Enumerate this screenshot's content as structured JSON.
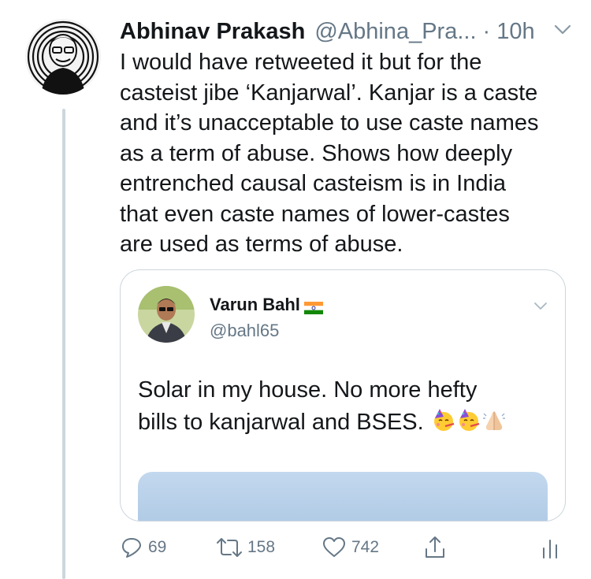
{
  "tweet": {
    "author_name": "Abhinav Prakash",
    "author_handle": "@Abhina_Pra...",
    "time": "· 10h",
    "text_lines": [
      "I would have retweeted it but for the",
      "casteist jibe ‘Kanjarwal’. Kanjar is a caste",
      "and it’s unacceptable to use caste names",
      "as a term of abuse. Shows how deeply",
      "entrenched causal casteism is in India",
      "that even caste names of lower-castes",
      "are used as terms of abuse."
    ]
  },
  "quoted": {
    "author_name": "Varun Bahl",
    "author_handle": "@bahl65",
    "text_lines": [
      "Solar in my house. No more hefty",
      "bills to kanjarwal and BSES."
    ],
    "emojis": [
      "partying-face",
      "partying-face",
      "folded-hands"
    ]
  },
  "actions": {
    "reply_count": "69",
    "retweet_count": "158",
    "like_count": "742"
  },
  "colors": {
    "text": "#14171a",
    "secondary": "#657786",
    "border": "#ccd6dd"
  }
}
